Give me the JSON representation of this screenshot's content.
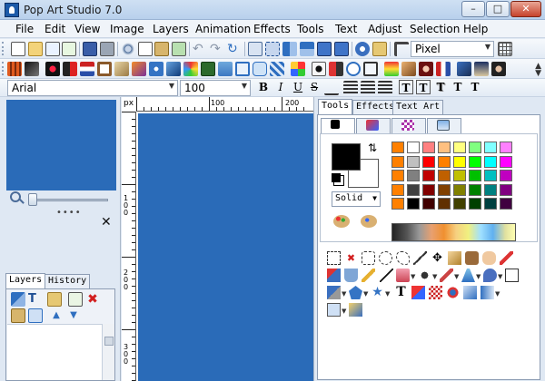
{
  "window": {
    "title": "Pop Art Studio 7.0",
    "controls": {
      "minimize": "–",
      "maximize": "□",
      "close": "✕"
    }
  },
  "menu": [
    "File",
    "Edit",
    "View",
    "Image",
    "Layers",
    "Animation",
    "Effects",
    "Tools",
    "Text",
    "Adjust",
    "Selection",
    "Help"
  ],
  "toolbar": {
    "unit_select": "Pixel"
  },
  "font_toolbar": {
    "font_family": "Arial",
    "font_size": "100",
    "bold": "B",
    "italic": "I",
    "underline": "U",
    "strike": "S",
    "text_styles": [
      "T",
      "T",
      "T",
      "T",
      "T"
    ]
  },
  "ruler": {
    "unit": "px",
    "top_labels": [
      "100",
      "200"
    ],
    "left_labels": [
      "100",
      "200",
      "300"
    ]
  },
  "left_panel": {
    "dots": "••••",
    "close": "✕",
    "tabs": [
      "Layers",
      "History"
    ]
  },
  "right_panel": {
    "tabs": [
      "Tools",
      "Effects",
      "Text Art"
    ],
    "fill_mode": "Solid",
    "swap_glyph": "⇅"
  },
  "colors": {
    "canvas_blue": "#2a6bb8",
    "palette_columns": [
      [
        "#ff8000",
        "#ff8000",
        "#ff8000",
        "#ff8000",
        "#ff8000"
      ],
      [
        "#ffffff",
        "#c0c0c0",
        "#808080",
        "#404040",
        "#000000"
      ],
      [
        "#ff8080",
        "#ff0000",
        "#c00000",
        "#800000",
        "#400000"
      ],
      [
        "#ffc080",
        "#ff8000",
        "#c06000",
        "#804000",
        "#603000"
      ],
      [
        "#ffff80",
        "#ffff00",
        "#c0c000",
        "#808000",
        "#404000"
      ],
      [
        "#80ff80",
        "#00ff00",
        "#00c000",
        "#008000",
        "#004000"
      ],
      [
        "#80ffff",
        "#00ffff",
        "#00c0c0",
        "#008080",
        "#004040"
      ],
      [
        "#ff80ff",
        "#ff00ff",
        "#c000c0",
        "#800080",
        "#400040"
      ]
    ]
  }
}
